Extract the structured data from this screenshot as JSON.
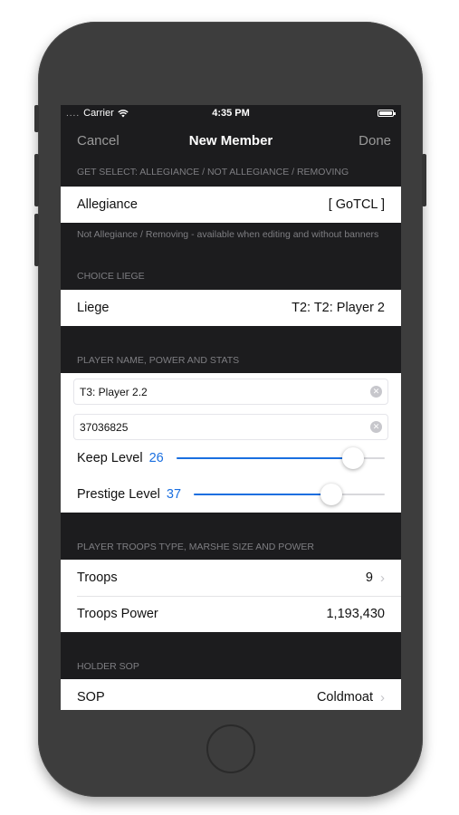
{
  "status_bar": {
    "carrier": "Carrier",
    "signal": "....",
    "time": "4:35 PM"
  },
  "nav": {
    "cancel": "Cancel",
    "title": "New Member",
    "done": "Done"
  },
  "allegiance_section": {
    "header": "GET SELECT: ALLEGIANCE / NOT ALLEGIANCE / REMOVING",
    "label": "Allegiance",
    "value": "[ GoTCL ]",
    "footer": "Not Allegiance / Removing - available when editing and without banners"
  },
  "liege_section": {
    "header": "CHOICE LIEGE",
    "label": "Liege",
    "value": "T2: T2: Player 2"
  },
  "player_section": {
    "header": "PLAYER NAME, POWER AND STATS",
    "name_value": "T3: Player 2.2",
    "power_value": "37036825",
    "keep_label": "Keep Level",
    "keep_value": "26",
    "keep_fraction": 0.85,
    "prestige_label": "Prestige Level",
    "prestige_value": "37",
    "prestige_fraction": 0.72
  },
  "troops_section": {
    "header": "PLAYER TROOPS TYPE, MARSHE SIZE AND POWER",
    "troops_label": "Troops",
    "troops_value": "9",
    "power_label": "Troops Power",
    "power_value": "1,193,430"
  },
  "sop_section": {
    "header": "HOLDER SOP",
    "label": "SOP",
    "value": "Coldmoat"
  },
  "colors": {
    "accent": "#1a6fe0",
    "dark_bg": "#1c1c1e",
    "phone": "#3d3d3d"
  }
}
